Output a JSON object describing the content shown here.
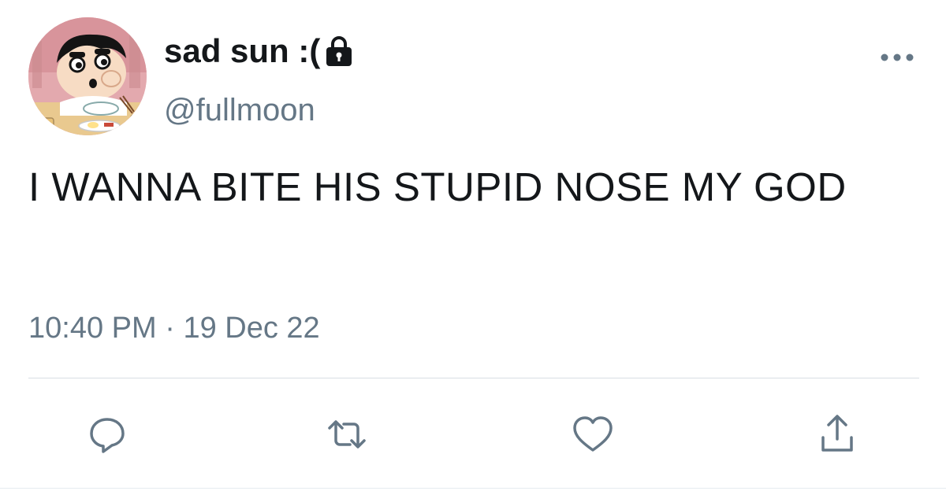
{
  "author": {
    "display_name": "sad sun :(",
    "handle": "@fullmoon",
    "protected": true,
    "avatar_icon": "cartoon-avatar"
  },
  "tweet": {
    "text": "I WANNA BITE HIS STUPID NOSE MY GOD",
    "time": "10:40 PM",
    "separator": "·",
    "date": "19 Dec 22"
  },
  "actions": [
    {
      "name": "reply",
      "icon": "speech-bubble-icon"
    },
    {
      "name": "retweet",
      "icon": "retweet-arrows-icon"
    },
    {
      "name": "like",
      "icon": "heart-outline-icon"
    },
    {
      "name": "share",
      "icon": "share-upload-icon"
    }
  ],
  "more_icon": "ellipsis-icon",
  "colors": {
    "text_primary": "#14171a",
    "text_secondary": "#657786",
    "icon": "#657786",
    "divider": "#d8dee3",
    "background": "#ffffff"
  }
}
